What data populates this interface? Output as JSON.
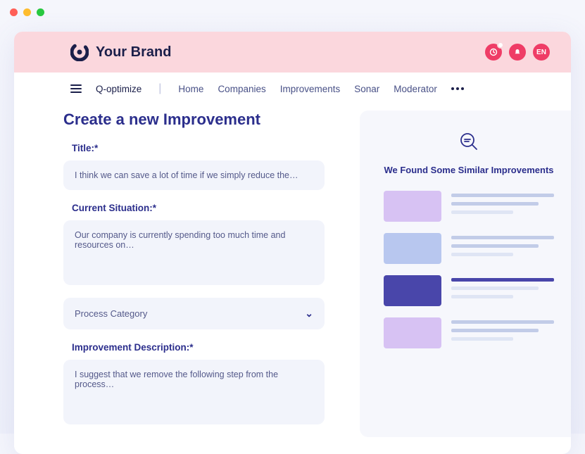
{
  "brand": {
    "name": "Your Brand"
  },
  "banner": {
    "lang": "EN"
  },
  "nav": {
    "app_label": "Q-optimize",
    "links": [
      "Home",
      "Companies",
      "Improvements",
      "Sonar",
      "Moderator"
    ]
  },
  "page": {
    "title": "Create a new Improvement",
    "fields": {
      "title_label": "Title:*",
      "title_value": "I think we can save a lot of time if we simply reduce the…",
      "situation_label": "Current Situation:*",
      "situation_value": "Our company is currently spending too much time and resources on…",
      "category_placeholder": "Process Category",
      "description_label": "Improvement Description:*",
      "description_value": "I suggest that we remove the following step from the process…"
    }
  },
  "similar": {
    "heading": "We Found Some Similar Improvements"
  }
}
